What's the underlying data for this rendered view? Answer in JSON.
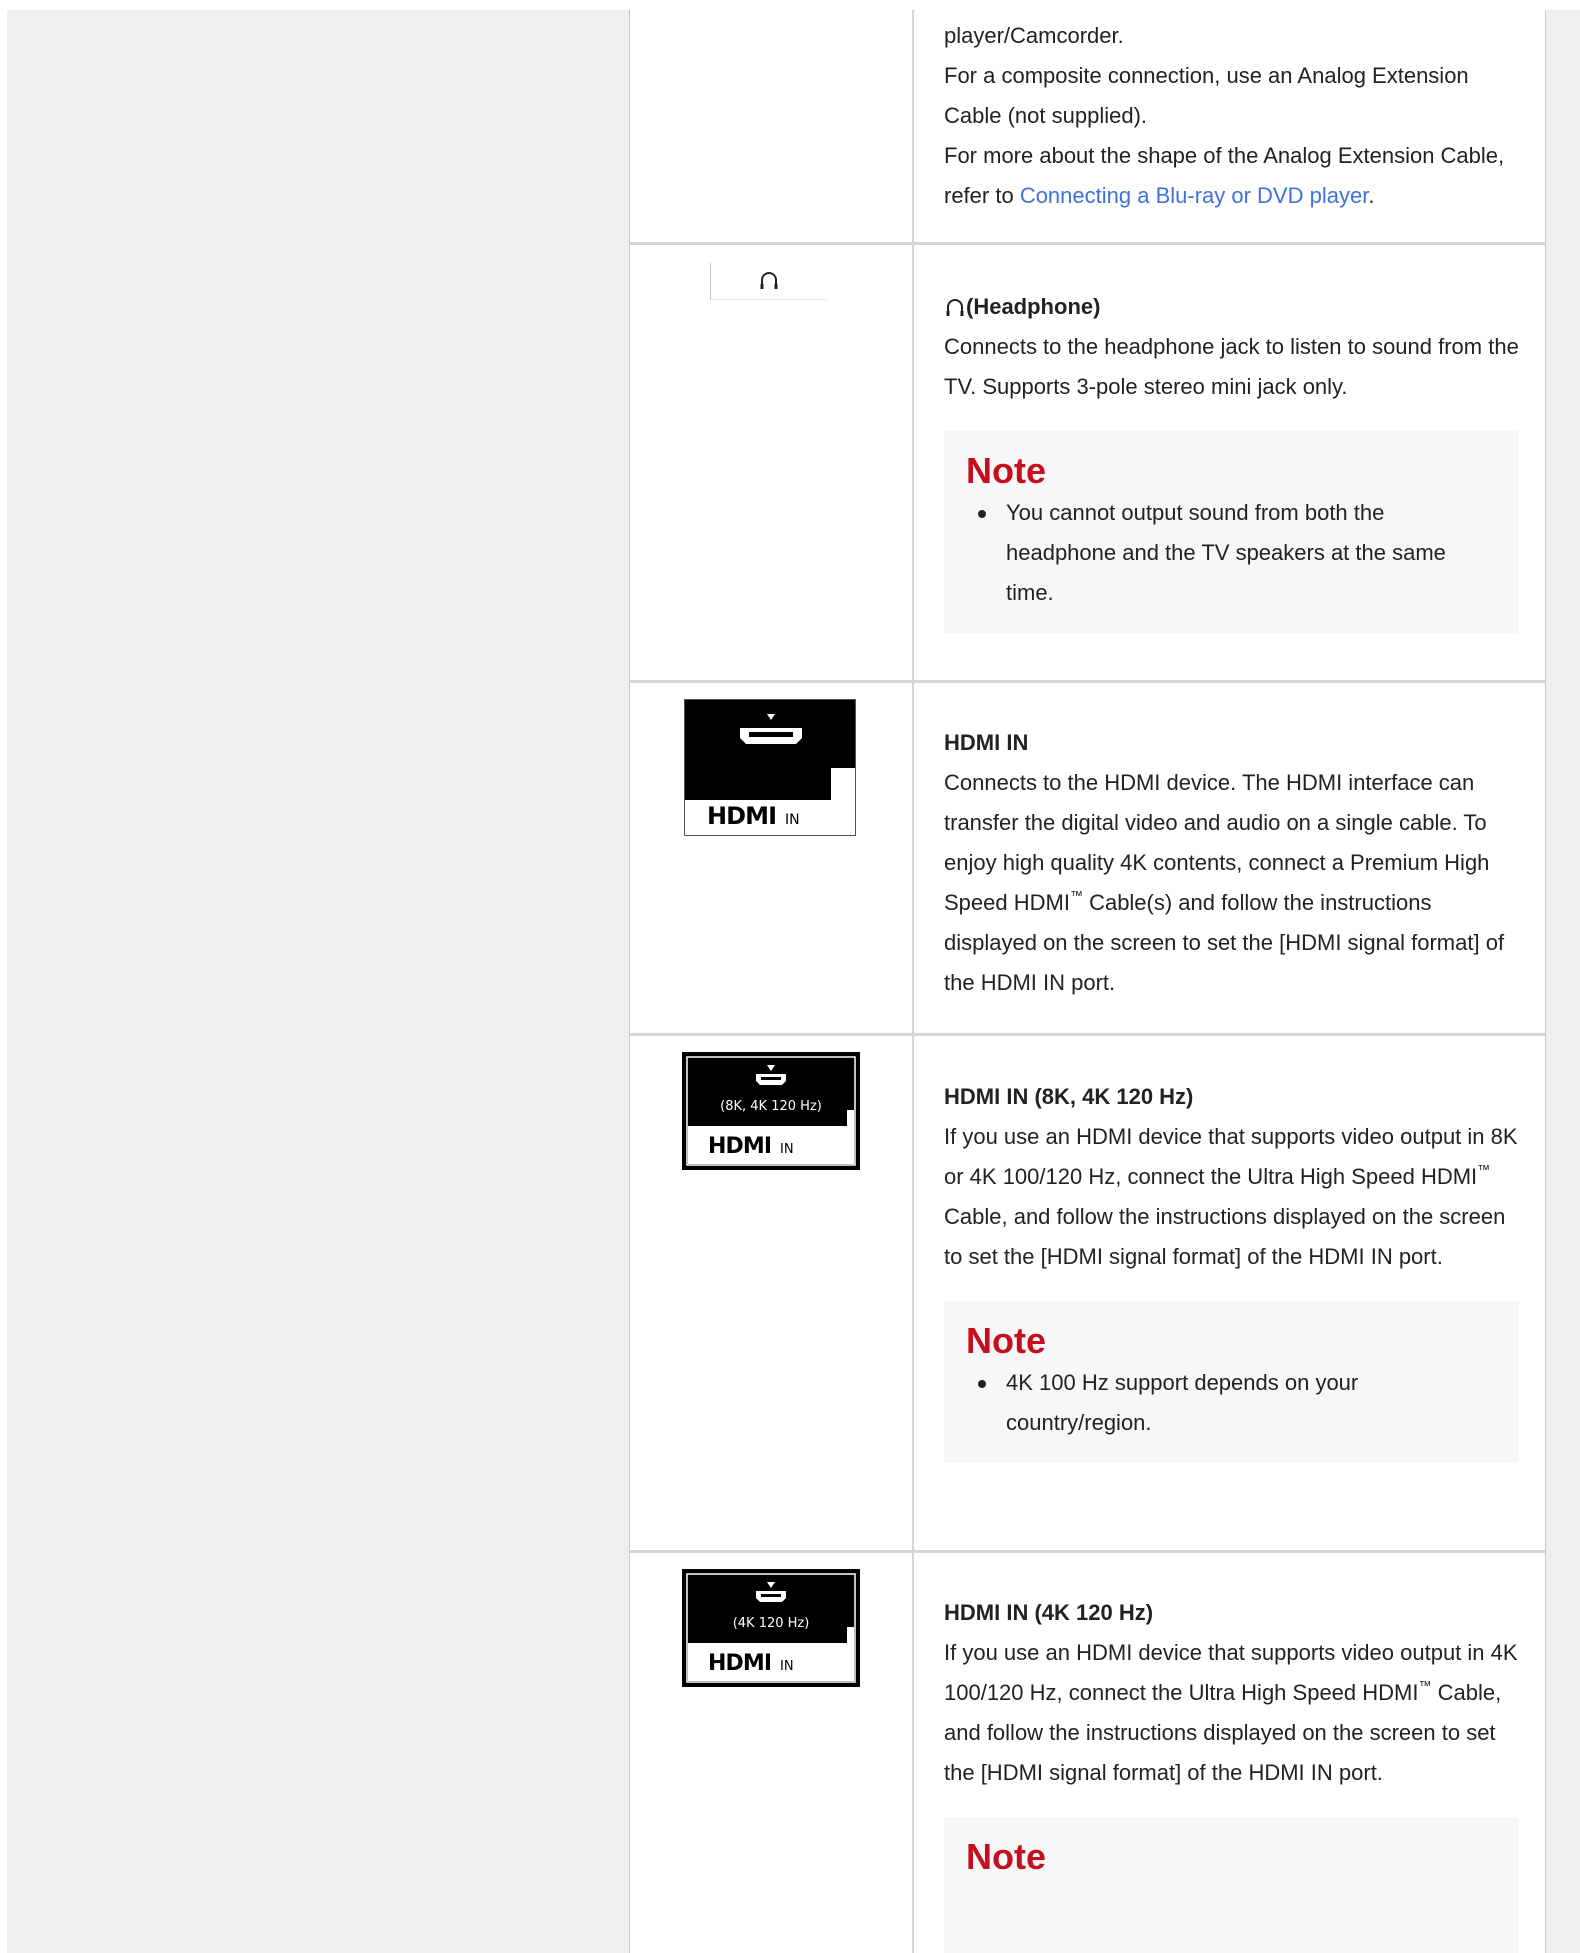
{
  "rows": {
    "analog": {
      "lines": [
        "player/Camcorder.",
        "For a composite connection, use an Analog Extension Cable (not supplied).",
        "For more about the shape of the Analog Extension Cable, refer to "
      ],
      "link": "Connecting a Blu-ray or DVD player",
      "link_suffix": "."
    },
    "headphone": {
      "title": "(Headphone)",
      "body": "Connects to the headphone jack to listen to sound from the TV. Supports 3-pole stereo mini jack only.",
      "note_title": "Note",
      "note_items": [
        "You cannot output sound from both the headphone and the TV speakers at the same time."
      ]
    },
    "hdmi_in": {
      "title": "HDMI IN",
      "body_pre": "Connects to the HDMI device. The HDMI interface can transfer the digital video and audio on a single cable. To enjoy high quality 4K contents, connect a Premium High Speed HDMI",
      "tm": "™",
      "body_post": " Cable(s) and follow the instructions displayed on the screen to set the [HDMI signal format] of the HDMI IN port.",
      "icon_label": "HDMI",
      "icon_in": "IN"
    },
    "hdmi_8k": {
      "title": "HDMI IN (8K, 4K 120 Hz)",
      "body_pre": "If you use an HDMI device that supports video output in 8K or 4K 100/120 Hz, connect the Ultra High Speed HDMI",
      "tm": "™",
      "body_post": " Cable, and follow the instructions displayed on the screen to set the [HDMI signal format] of the HDMI IN port.",
      "note_title": "Note",
      "note_items": [
        "4K 100 Hz support depends on your country/region."
      ],
      "icon_label": "HDMI",
      "icon_in": "IN",
      "icon_caption": "(8K, 4K 120 Hz)"
    },
    "hdmi_4k": {
      "title": "HDMI IN (4K 120 Hz)",
      "body_pre": "If you use an HDMI device that supports video output in 4K 100/120 Hz, connect the Ultra High Speed HDMI",
      "tm": "™",
      "body_post": " Cable, and follow the instructions displayed on the screen to set the [HDMI signal format] of the HDMI IN port.",
      "note_title": "Note",
      "icon_label": "HDMI",
      "icon_in": "IN",
      "icon_caption": "(4K 120 Hz)"
    }
  },
  "colors": {
    "link": "#3f72d8",
    "note_title": "#c50f1e",
    "page_background": "#efefef",
    "note_background": "#f7f7f7"
  }
}
